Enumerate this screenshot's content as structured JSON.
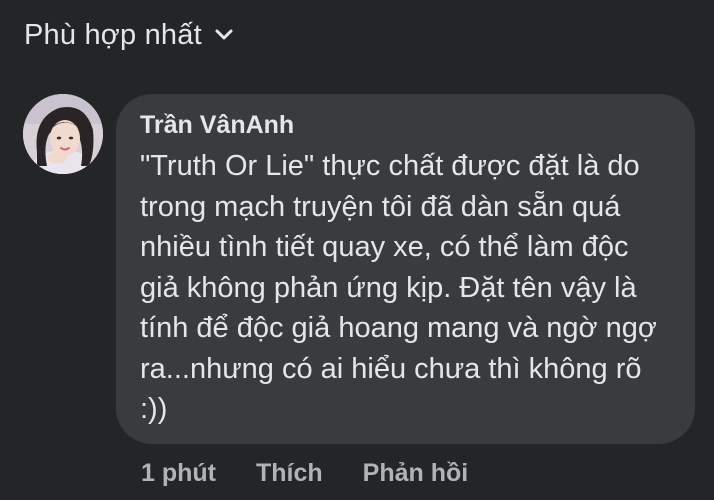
{
  "sort": {
    "label": "Phù hợp nhất",
    "icon": "chevron-down-icon"
  },
  "comment": {
    "author": "Trần VânAnh",
    "text": "\"Truth Or Lie\" thực chất được đặt là do trong mạch truyện tôi đã dàn sẵn quá nhiều tình tiết quay xe, có thể làm độc giả không phản ứng kịp. Đặt tên vậy là tính để độc giả hoang mang và ngờ ngợ ra...nhưng có ai hiểu chưa thì không rõ :))",
    "avatar": "avatar",
    "time": "1 phút",
    "like_label": "Thích",
    "reply_label": "Phản hồi"
  },
  "colors": {
    "background": "#242526",
    "bubble": "#3a3b3c",
    "primary_text": "#e4e6eb",
    "secondary_text": "#b0b3b8"
  }
}
